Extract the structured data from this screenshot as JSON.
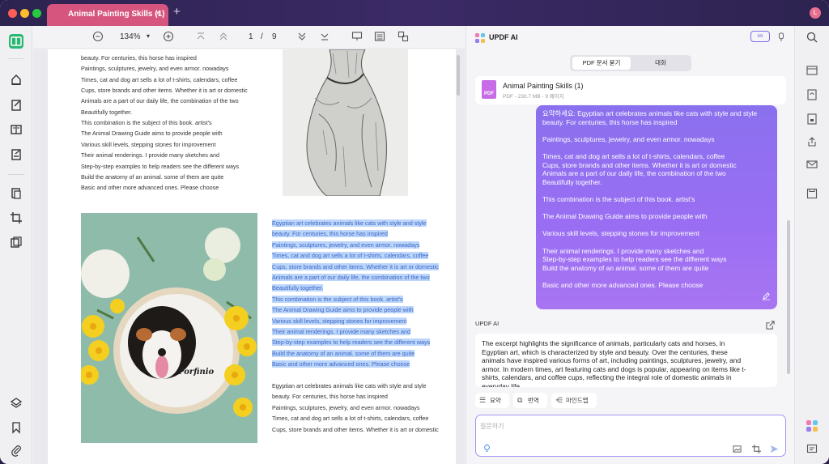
{
  "window": {
    "tab_title": "Animal Painting Skills (1)",
    "tab_close": "×",
    "new_tab": "+",
    "avatar": "L"
  },
  "toolbar": {
    "zoom": "134%",
    "zoom_caret": "▾",
    "page_current": "1",
    "page_sep": "/",
    "page_total": "9"
  },
  "document": {
    "top_lines": [
      "beauty. For centuries, this horse has inspired",
      "Paintings, sculptures, jewelry, and even armor. nowadays",
      "Times, cat and dog art sells a lot of t-shirts, calendars, coffee",
      "Cups, store brands and other items. Whether it is art or domestic",
      "Animals are a part of our daily life, the combination of the two",
      "Beautifully together.",
      "This combination is the subject of this book. artist's",
      "The Animal Drawing Guide aims to provide people with",
      "Various skill levels, stepping stones for improvement",
      "Their animal renderings. I provide many sketches and",
      "Step-by-step examples to help readers see the different ways",
      "Build the anatomy of an animal. some of them are quite",
      "Basic and other more advanced ones. Please choose"
    ],
    "highlight_lines": [
      "Egyptian art celebrates animals like cats with style and style",
      "beauty. For centuries, this horse has inspired",
      "Paintings, sculptures, jewelry, and even armor. nowadays",
      "Times, cat and dog art sells a lot of t-shirts, calendars, coffee",
      "Cups, store brands and other items. Whether it is art or domestic",
      "Animals are a part of our daily life, the combination of the two",
      "Beautifully together.",
      "This combination is the subject of this book. artist's",
      "The Animal Drawing Guide aims to provide people with",
      "Various skill levels, stepping stones for improvement",
      "Their animal renderings. I provide many sketches and",
      "Step-by-step examples to help readers see the different ways",
      "Build the anatomy of an animal. some of them are quite",
      "Basic and other more advanced ones. Please choose"
    ],
    "bottom_lines": [
      "Egyptian art celebrates animals like cats with style and style",
      "beauty. For centuries, this horse has inspired",
      "Paintings, sculptures, jewelry, and even armor. nowadays",
      "Times, cat and dog art sells a lot of t-shirts, calendars, coffee",
      "Cups, store brands and other items. Whether it is art or domestic"
    ],
    "photo_signature": "Porfinio"
  },
  "ai": {
    "title": "UPDF AI",
    "infinity": "∞",
    "seg_tab_a": "PDF 문서 묻기",
    "seg_tab_b": "대화",
    "file_name": "Animal Painting Skills (1)",
    "file_meta": "PDF - 230.7 MB - 9 페이지",
    "pdf_badge": "PDF",
    "user_lines": [
      "요약하세요: Egyptian art celebrates animals like cats with style and style",
      "beauty. For centuries, this horse has inspired",
      "",
      "Paintings, sculptures, jewelry, and even armor. nowadays",
      "",
      "Times, cat and dog art sells a lot of t-shirts, calendars, coffee",
      "Cups, store brands and other items. Whether it is art or domestic",
      "Animals are a part of our daily life, the combination of the two",
      "Beautifully together.",
      "",
      "This combination is the subject of this book. artist's",
      "",
      "The Animal Drawing Guide aims to provide people with",
      "",
      "Various skill levels, stepping stones for improvement",
      "",
      "Their animal renderings. I provide many sketches and",
      "Step-by-step examples to help readers see the different ways",
      "Build the anatomy of an animal. some of them are quite",
      "",
      "Basic and other more advanced ones. Please choose"
    ],
    "answer_label": "UPDF AI",
    "answer_lines": [
      "The excerpt highlights the significance of animals, particularly cats and horses, in",
      "Egyptian art, which is characterized by style and beauty. Over the centuries, these",
      "animals have inspired various forms of art, including paintings, sculptures, jewelry, and",
      "armor. In modern times, art featuring cats and dogs is popular, appearing on items like t-",
      "shirts, calendars, and coffee cups, reflecting the integral role of domestic animals in",
      "everyday life."
    ],
    "chips": {
      "summarize": "요약",
      "translate": "번역",
      "mindmap": "마인드맵"
    },
    "input_placeholder": "질문하기"
  },
  "colors": {
    "accent": "#8a70ee",
    "tab": "#d6557e",
    "highlight": "#bcd6fb"
  }
}
